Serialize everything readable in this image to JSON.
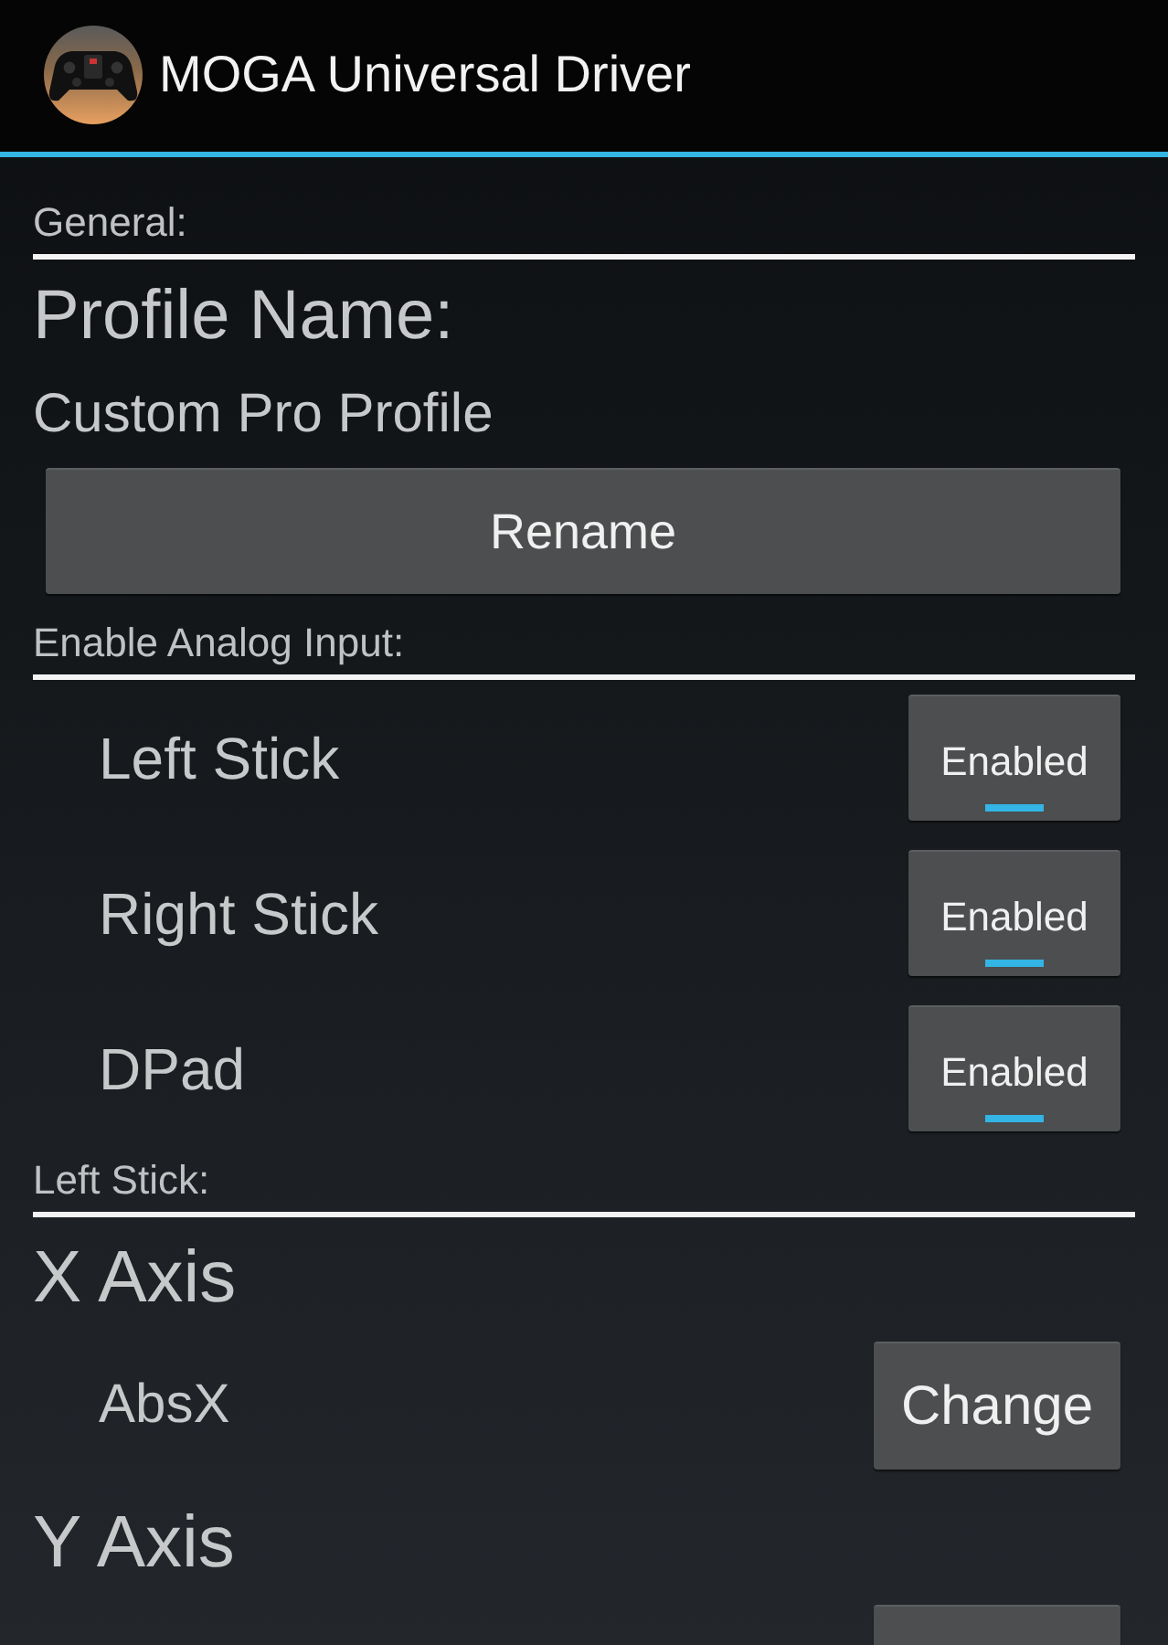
{
  "action_bar": {
    "title": "MOGA Universal Driver"
  },
  "general": {
    "heading": "General:",
    "profile_label": "Profile Name:",
    "profile_name": "Custom Pro Profile",
    "rename_button": "Rename"
  },
  "analog_input": {
    "heading": "Enable Analog Input:",
    "toggles": [
      {
        "label": "Left Stick",
        "state": "Enabled",
        "on": true
      },
      {
        "label": "Right Stick",
        "state": "Enabled",
        "on": true
      },
      {
        "label": "DPad",
        "state": "Enabled",
        "on": true
      }
    ]
  },
  "left_stick": {
    "heading": "Left Stick:",
    "items": [
      {
        "kind": "axis",
        "label": "X Axis"
      },
      {
        "kind": "mapping",
        "value": "AbsX",
        "button": "Change"
      },
      {
        "kind": "axis",
        "label": "Y Axis"
      },
      {
        "kind": "mapping"
      }
    ]
  }
}
